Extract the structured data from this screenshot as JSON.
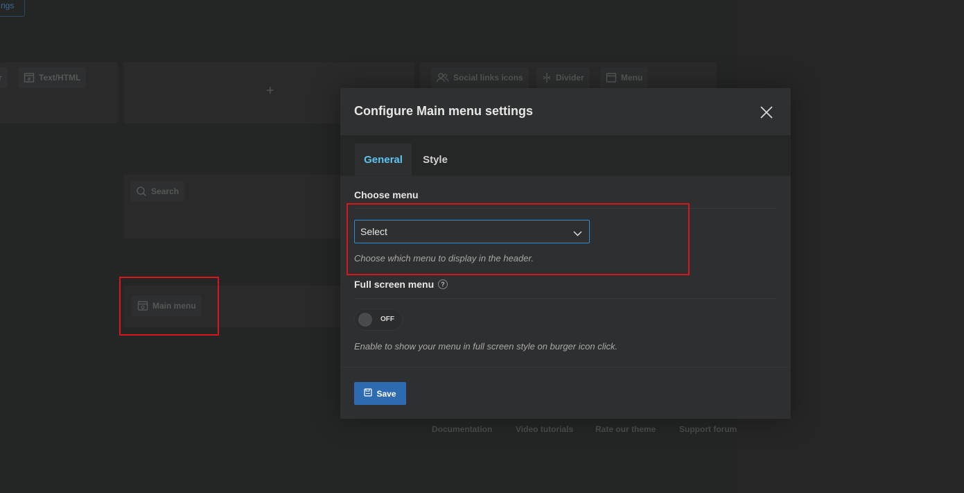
{
  "background": {
    "top_left_fragment": "ngs",
    "chips": {
      "left_fragment": "r",
      "text_html": "Text/HTML",
      "search": "Search",
      "main_menu": "Main menu",
      "social_links": "Social links icons",
      "divider": "Divider",
      "menu": "Menu"
    },
    "plus": "+",
    "footer_links": [
      "Documentation",
      "Video tutorials",
      "Rate our theme",
      "Support forum"
    ]
  },
  "modal": {
    "title": "Configure Main menu settings",
    "close_icon": "close-icon",
    "tabs": [
      {
        "label": "General",
        "active": true
      },
      {
        "label": "Style",
        "active": false
      }
    ],
    "choose_menu": {
      "label": "Choose menu",
      "selected": "Select",
      "help": "Choose which menu to display in the header."
    },
    "full_screen_menu": {
      "label": "Full screen menu",
      "help_icon_glyph": "?",
      "toggle_text": "OFF",
      "help": "Enable to show your menu in full screen style on burger icon click."
    },
    "save_label": "Save"
  },
  "colors": {
    "accent_tab": "#5cc6f0",
    "select_border": "#2d8bd6",
    "save_button": "#2e6bb0",
    "highlight": "#d9161c"
  }
}
